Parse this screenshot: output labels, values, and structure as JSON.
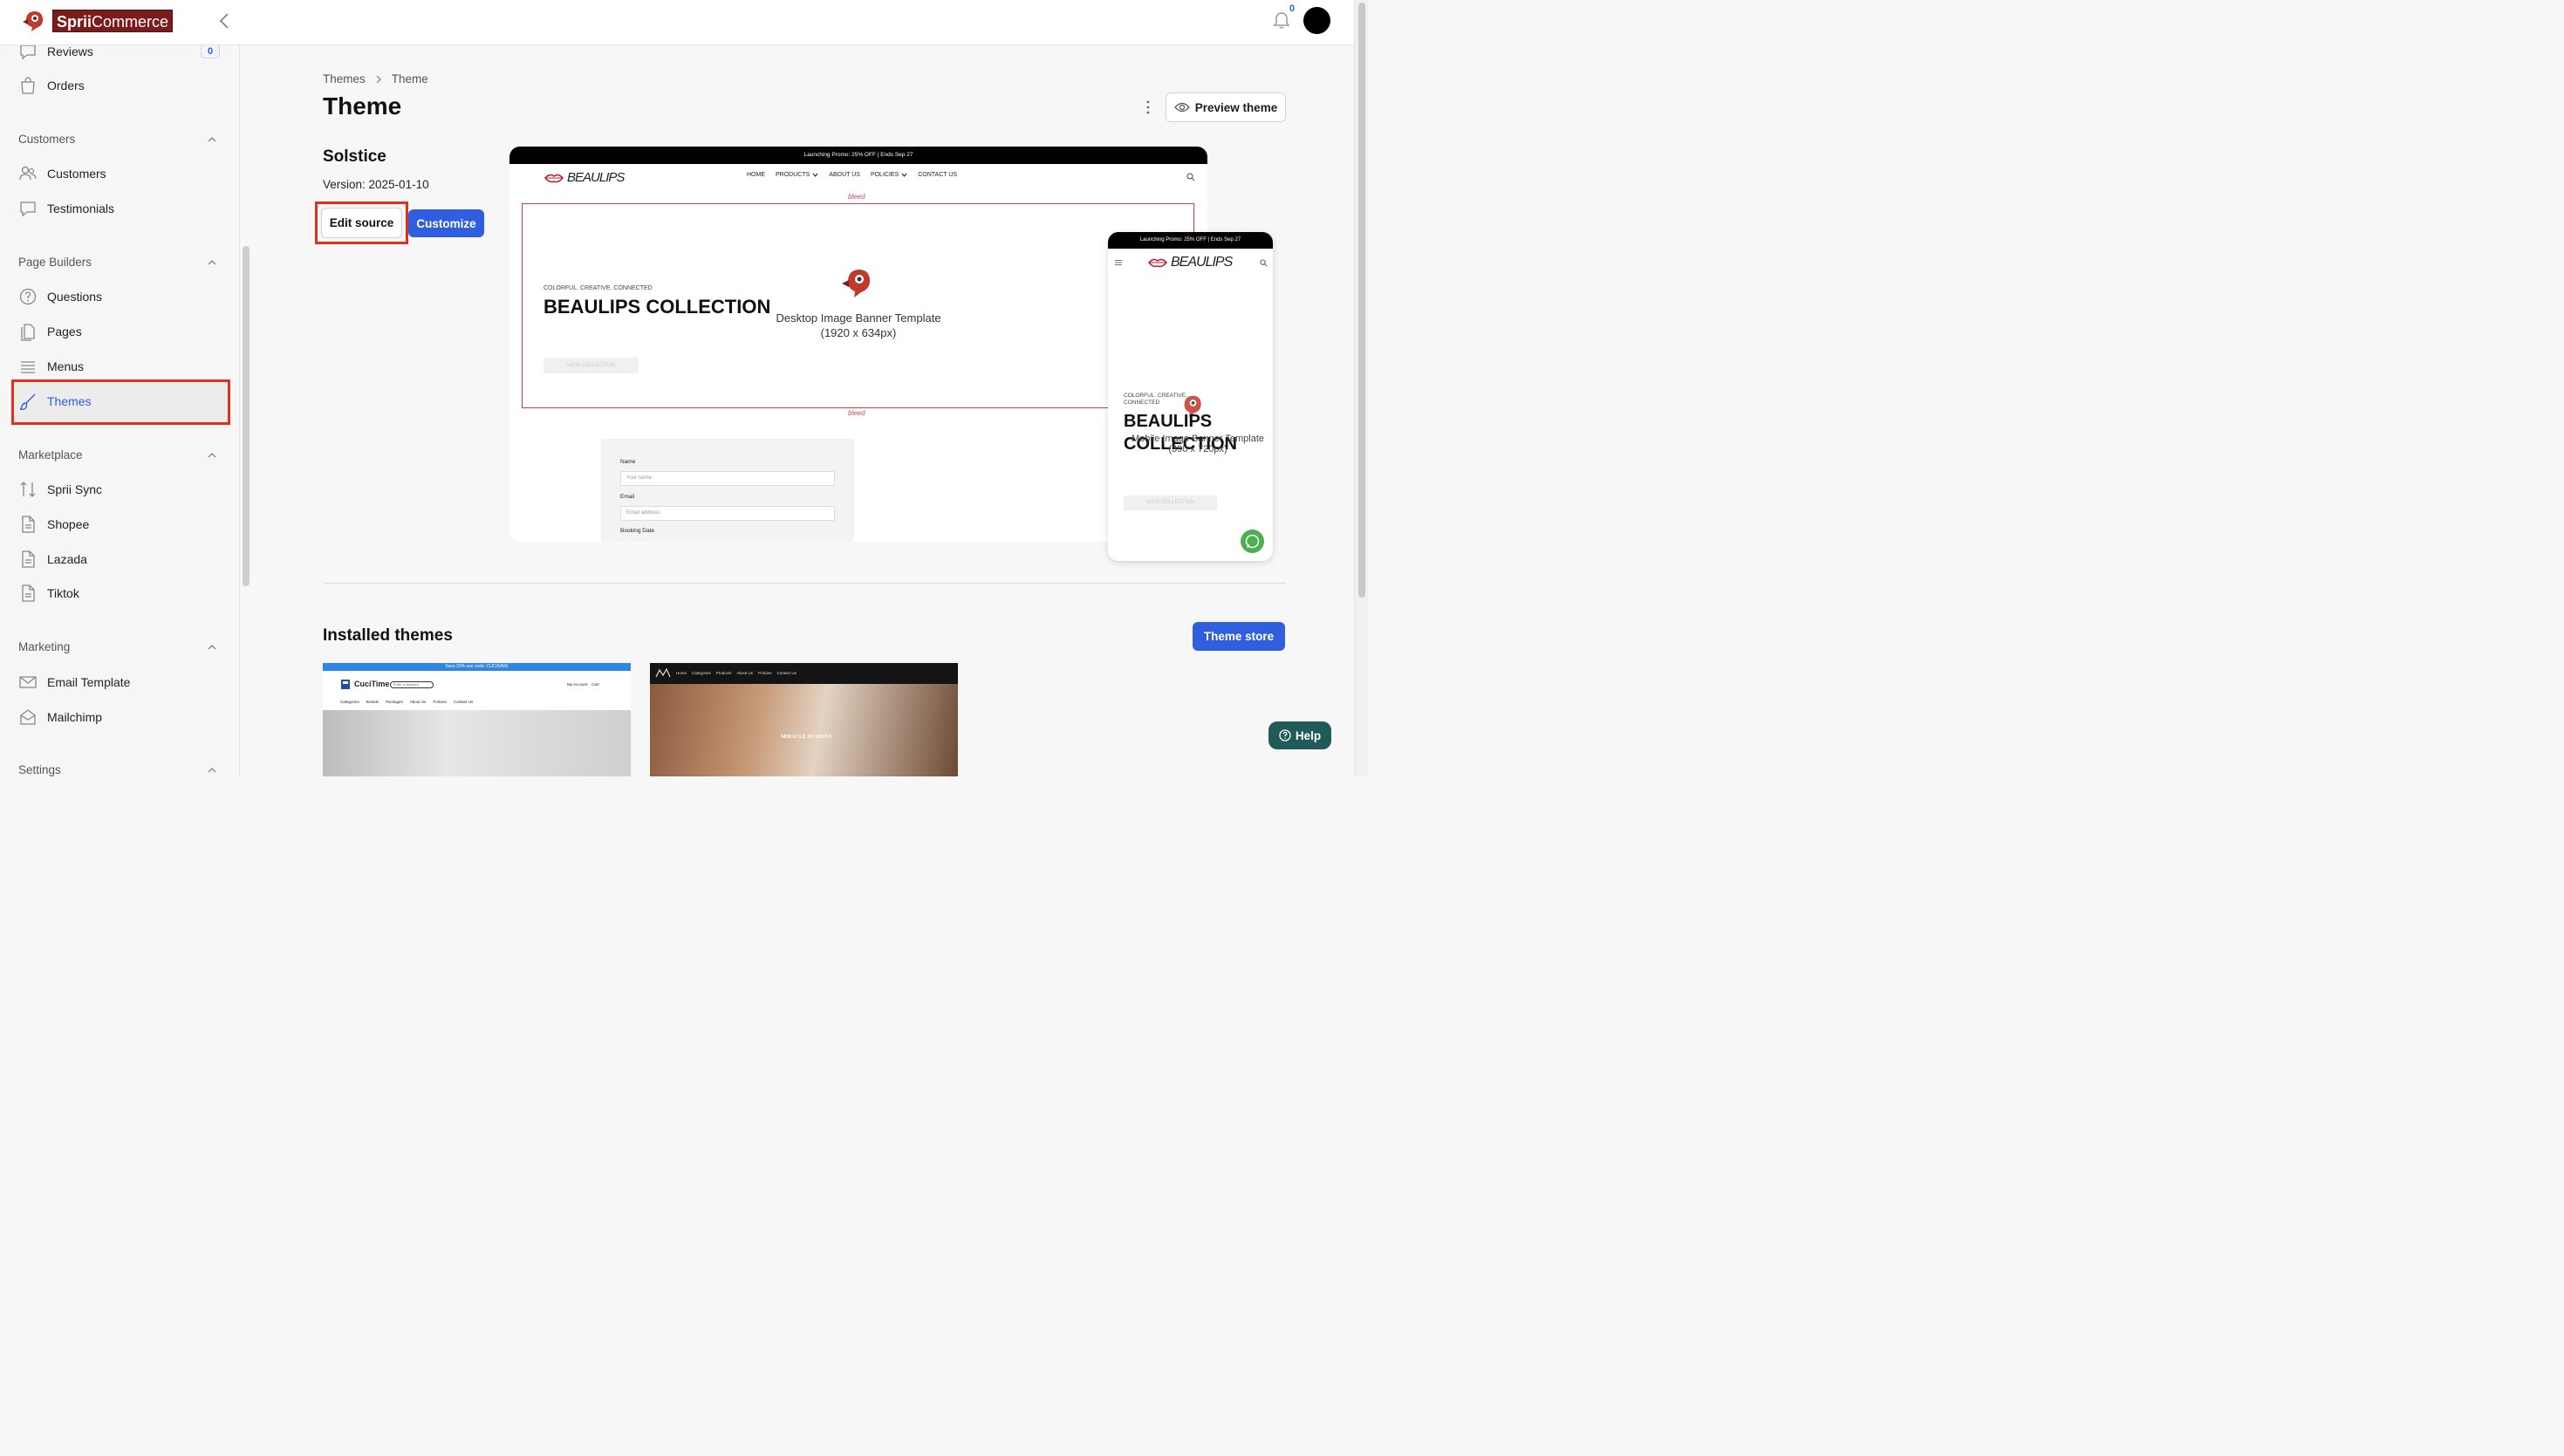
{
  "brand": {
    "name_part1": "Sprii",
    "name_part2": "Commerce"
  },
  "header": {
    "notification_count": "0"
  },
  "sidebar": {
    "items_top": [
      {
        "label": "Reviews",
        "badge": "0"
      },
      {
        "label": "Orders"
      }
    ],
    "groups": {
      "customers": {
        "label": "Customers",
        "items": [
          "Customers",
          "Testimonials"
        ]
      },
      "page_builders": {
        "label": "Page Builders",
        "items": [
          "Questions",
          "Pages",
          "Menus",
          "Themes"
        ]
      },
      "marketplace": {
        "label": "Marketplace",
        "items": [
          "Sprii Sync",
          "Shopee",
          "Lazada",
          "Tiktok"
        ]
      },
      "marketing": {
        "label": "Marketing",
        "items": [
          "Email Template",
          "Mailchimp"
        ]
      },
      "settings": {
        "label": "Settings"
      }
    }
  },
  "breadcrumb": {
    "parent": "Themes",
    "current": "Theme"
  },
  "page": {
    "title": "Theme",
    "preview_button": "Preview theme"
  },
  "current_theme": {
    "name": "Solstice",
    "version": "Version: 2025-01-10",
    "edit_button": "Edit source",
    "customize_button": "Customize"
  },
  "preview": {
    "promo": "Launching Promo: 25% OFF | Ends Sep 27",
    "logo_text": "BEAULIPS",
    "nav": [
      "HOME",
      "PRODUCTS",
      "ABOUT US",
      "POLICIES",
      "CONTACT US"
    ],
    "bleed": "bleed",
    "banner_subtitle": "COLORFUL. CREATIVE. CONNECTED",
    "banner_title": "BEAULIPS COLLECTION",
    "banner_button": "VIEW COLLECTION",
    "desktop_caption_line1": "Desktop Image Banner Template",
    "desktop_caption_line2": "(1920 x 634px)",
    "form": {
      "name_label": "Name",
      "name_placeholder": "Your name",
      "email_label": "Email",
      "email_placeholder": "Email address",
      "date_label": "Booking Date"
    },
    "mobile_subtitle": "COLORFUL. CREATIVE. CONNECTED",
    "mobile_title_line1": "BEAULIPS",
    "mobile_title_line2": "COLLECTION",
    "mobile_caption_line1": "Mobile Image Banner Template",
    "mobile_caption_line2": "(390 x 720px)"
  },
  "installed": {
    "title": "Installed themes",
    "store_button": "Theme store",
    "theme1": {
      "promo": "Save 20% use code: CUCISAVE",
      "logo": "CuciTime",
      "search": "Enter a keyword",
      "account": "My Account",
      "cart": "Cart",
      "nav": [
        "Categories",
        "Brands",
        "Packages",
        "About Us",
        "Policies",
        "Contact Us"
      ]
    },
    "theme2": {
      "nav": [
        "Home",
        "Categories",
        "Products",
        "About Us",
        "Policies",
        "Contact Us"
      ],
      "hero_text": "MIRACLE SCARVES"
    }
  },
  "help": {
    "label": "Help"
  }
}
